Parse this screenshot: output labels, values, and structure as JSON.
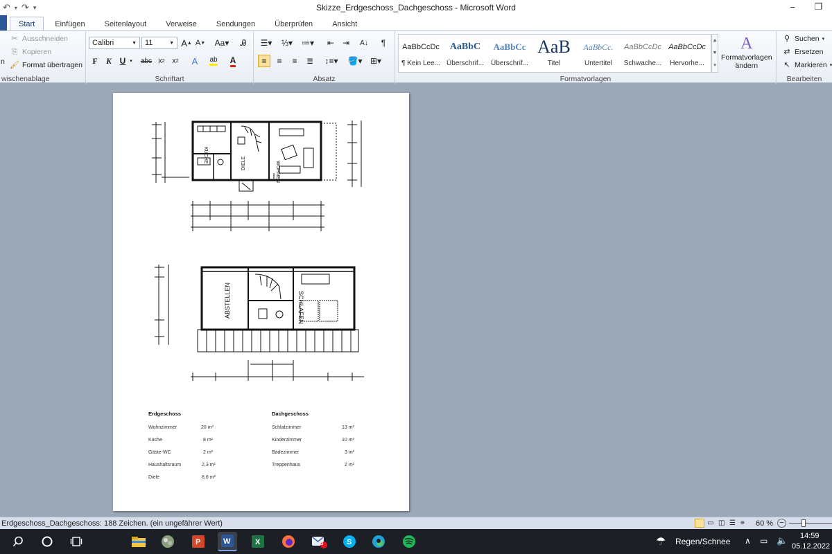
{
  "window": {
    "title": "Skizze_Erdgeschoss_Dachgeschoss - Microsoft Word"
  },
  "tabs": [
    "Start",
    "Einfügen",
    "Seitenlayout",
    "Verweise",
    "Sendungen",
    "Überprüfen",
    "Ansicht"
  ],
  "clipboard": {
    "cut": "Ausschneiden",
    "copy": "Kopieren",
    "format_painter": "Format übertragen",
    "label": "wischenablage",
    "paste_fragment": "n"
  },
  "font": {
    "name": "Calibri",
    "size": "11",
    "label": "Schriftart"
  },
  "paragraph": {
    "label": "Absatz"
  },
  "styles": {
    "label": "Formatvorlagen",
    "items": [
      {
        "preview": "AaBbCcDc",
        "name": "¶ Kein Lee..."
      },
      {
        "preview": "AaBbC",
        "name": "Überschrif..."
      },
      {
        "preview": "AaBbCc",
        "name": "Überschrif..."
      },
      {
        "preview": "AaB",
        "name": "Titel"
      },
      {
        "preview": "AaBbCc.",
        "name": "Untertitel"
      },
      {
        "preview": "AaBbCcDc",
        "name": "Schwache..."
      },
      {
        "preview": "AaBbCcDc",
        "name": "Hervorhe..."
      }
    ],
    "change_label_1": "Formatvorlagen",
    "change_label_2": "ändern"
  },
  "editing": {
    "find": "Suchen",
    "replace": "Ersetzen",
    "select": "Markieren",
    "label": "Bearbeiten"
  },
  "document": {
    "room_labels": {
      "kitchen": "KÜCHE",
      "hall": "DIELE",
      "living": "WOHNEN",
      "storage": "ABSTELLEN",
      "bedroom": "SCHLAFEN"
    },
    "table_left": {
      "header": "Erdgeschoss",
      "rows": [
        {
          "room": "Wohnzimmer",
          "area": "20  m²"
        },
        {
          "room": "Küche",
          "area": "8  m²"
        },
        {
          "room": "Gäste-WC",
          "area": "2  m²"
        },
        {
          "room": "Haushaltsraum",
          "area": "2,3 m²"
        },
        {
          "room": "Diele",
          "area": "8,6 m²"
        }
      ]
    },
    "table_right": {
      "header": "Dachgeschoss",
      "rows": [
        {
          "room": "Schlafzimmer",
          "area": "13 m²"
        },
        {
          "room": "Kinderzimmer",
          "area": "10 m²"
        },
        {
          "room": "Badezimmer",
          "area": "3 m²"
        },
        {
          "room": "Treppenhaus",
          "area": "2 m²"
        }
      ]
    }
  },
  "statusbar": {
    "text": "Erdgeschoss_Dachgeschoss: 188 Zeichen. (ein ungefährer Wert)",
    "zoom": "60 %"
  },
  "taskbar": {
    "weather": "Regen/Schnee",
    "time": "14:59",
    "date": "05.12.2022",
    "mail_badge": "3"
  },
  "colors": {
    "accent": "#2b5797",
    "taskbar": "#1c1f26"
  }
}
